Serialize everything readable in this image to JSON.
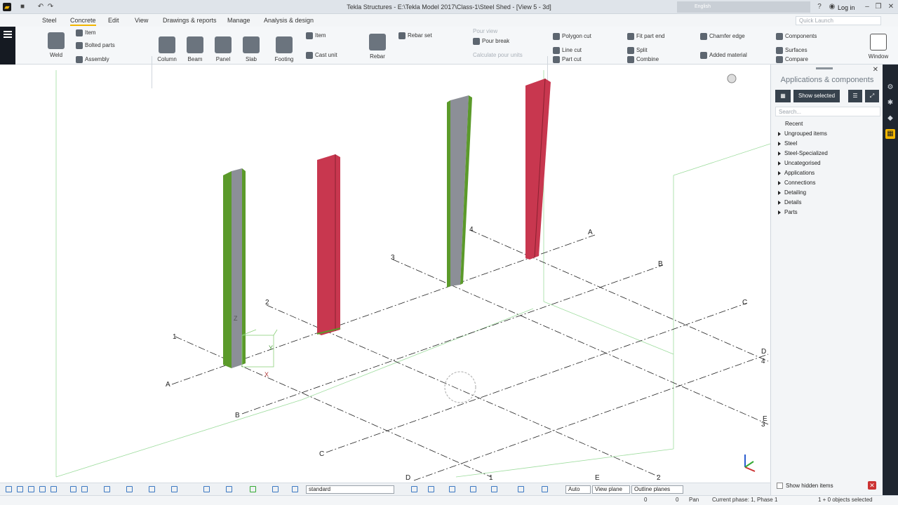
{
  "window": {
    "title": "Tekla Structures - E:\\Tekla Model 2017\\Class-1\\Steel Shed  - [View 5 - 3d]",
    "language": "English",
    "login": "Log in",
    "quick_launch": "Quick Launch"
  },
  "menu": [
    "Steel",
    "Concrete",
    "Edit",
    "View",
    "Drawings & reports",
    "Manage",
    "Analysis & design"
  ],
  "ribbon": {
    "weld": "Weld",
    "item": "Item",
    "bolted_parts": "Bolted parts",
    "assembly": "Assembly",
    "column": "Column",
    "beam": "Beam",
    "panel": "Panel",
    "slab": "Slab",
    "footing": "Footing",
    "item2": "Item",
    "cast_unit": "Cast unit",
    "rebar": "Rebar",
    "rebar_set": "Rebar set",
    "pour_view": "Pour view",
    "pour_break": "Pour break",
    "calc_pour": "Calculate pour units",
    "polygon_cut": "Polygon cut",
    "line_cut": "Line cut",
    "part_cut": "Part cut",
    "fit_part_end": "Fit part end",
    "split": "Split",
    "combine": "Combine",
    "chamfer_edge": "Chamfer edge",
    "added_material": "Added material",
    "components": "Components",
    "surfaces": "Surfaces",
    "compare": "Compare",
    "window": "Window"
  },
  "panel": {
    "title": "Applications & components",
    "show_selected": "Show selected",
    "search_placeholder": "Search...",
    "recent": "Recent",
    "items": [
      "Ungrouped items",
      "Steel",
      "Steel-Specialized",
      "Uncategorised",
      "Applications",
      "Connections",
      "Detailing",
      "Details",
      "Parts"
    ],
    "show_hidden": "Show hidden items"
  },
  "grid_labels": {
    "left_axes": [
      "1",
      "2",
      "3",
      "4"
    ],
    "right_axes": [
      "A",
      "B",
      "C",
      "D"
    ],
    "far_axes": [
      "D",
      "E"
    ],
    "row_labels": [
      "4",
      "3",
      "2",
      "1"
    ]
  },
  "axes": {
    "z": "Z",
    "y": "Y",
    "x": "X"
  },
  "bottom": {
    "filter": "standard",
    "auto": "Auto",
    "view_plane": "View plane",
    "outline_planes": "Outline planes"
  },
  "status": {
    "coord1": "0",
    "coord2": "0",
    "mode": "Pan",
    "phase": "Current phase: 1, Phase 1",
    "selected": "1 + 0 objects selected"
  },
  "colors": {
    "accent": "#f2b600",
    "red_column": "#c8374f",
    "green_column": "#5b9a2a",
    "grey_web": "#8c8f97"
  }
}
